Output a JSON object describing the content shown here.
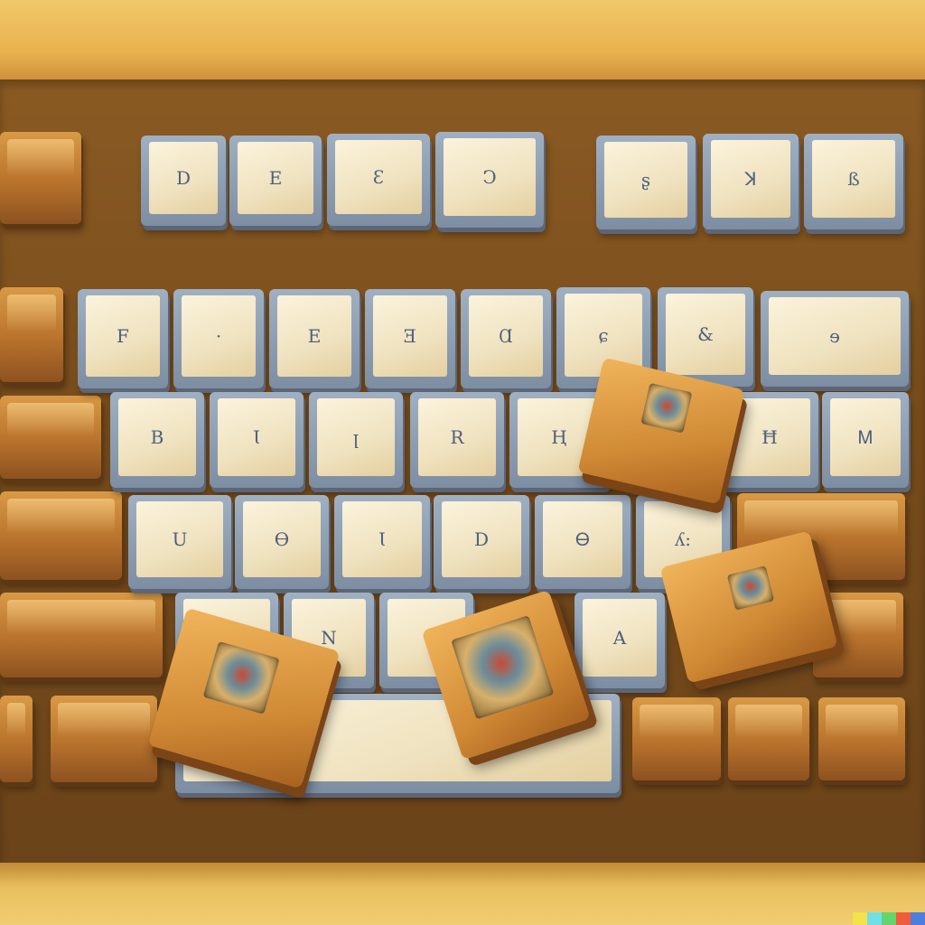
{
  "scene": {
    "subject": "oil-painting style keyboard with floating wooden keycap tiles"
  },
  "keys": {
    "row1": [
      "D",
      "E",
      "Ɛ",
      "Ↄ",
      "ʂ",
      "ꓘ",
      "ß"
    ],
    "row2": [
      "F",
      "·",
      "E",
      "Ǝ",
      "Ɑ",
      "ɕ",
      "&",
      "ɘ"
    ],
    "row3": [
      "B",
      "Ɩ",
      "ꞁ",
      "R",
      "Ⱨ",
      "",
      "Ħ",
      "Ꮇ"
    ],
    "row4": [
      "U",
      "Ɵ",
      "Ɩ",
      "D",
      "Ꮎ",
      "ʎ:"
    ],
    "row5": [
      "",
      "N",
      "",
      "A"
    ]
  },
  "signature_colors": [
    "#f4e24a",
    "#6fe0e8",
    "#64d46b",
    "#ef5b3b",
    "#4a7fe0"
  ]
}
